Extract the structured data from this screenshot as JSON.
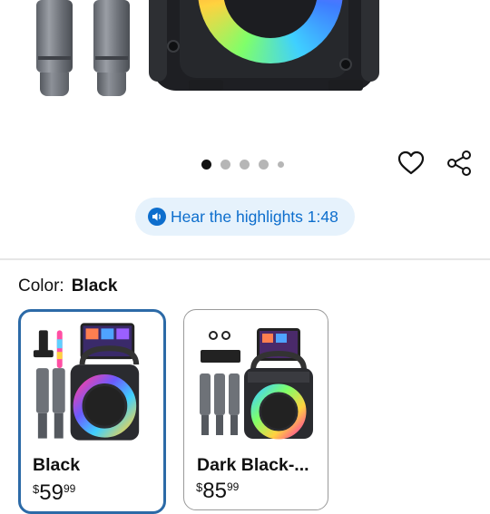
{
  "gallery": {
    "dot_count": 5,
    "active_index": 0
  },
  "actions": {
    "favorite_icon": "heart-icon",
    "share_icon": "share-icon"
  },
  "highlights": {
    "label": "Hear the highlights 1:48",
    "icon": "audio-icon",
    "color": "#0d6ecd"
  },
  "color_picker": {
    "label": "Color:",
    "selected": "Black",
    "options": [
      {
        "name": "Black",
        "price_symbol": "$",
        "price_whole": "59",
        "price_cents": "99"
      },
      {
        "name": "Dark Black-...",
        "price_symbol": "$",
        "price_whole": "85",
        "price_cents": "99"
      }
    ]
  },
  "colors": {
    "accent": "#0d6ecd",
    "selected_border": "#2c6aa7",
    "highlights_bg": "#e6f2fc"
  }
}
